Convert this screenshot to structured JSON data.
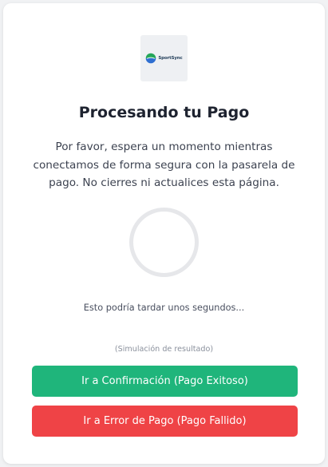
{
  "logo": {
    "text": "SportSync",
    "icon": "sportsync-logo-icon",
    "colors": {
      "top": "#25a65a",
      "bottom": "#2f6fd1"
    }
  },
  "title": "Procesando tu Pago",
  "description": "Por favor, espera un momento mientras conectamos de forma segura con la pasarela de pago. No cierres ni actualices esta página.",
  "spinner": {
    "icon": "loading-spinner"
  },
  "wait_text": "Esto podría tardar unos segundos...",
  "simulation_note": "(Simulación de resultado)",
  "buttons": {
    "success": {
      "label": "Ir a Confirmación (Pago Exitoso)",
      "color": "#1fb57b"
    },
    "error": {
      "label": "Ir a Error de Pago (Pago Fallido)",
      "color": "#ef4346"
    }
  }
}
